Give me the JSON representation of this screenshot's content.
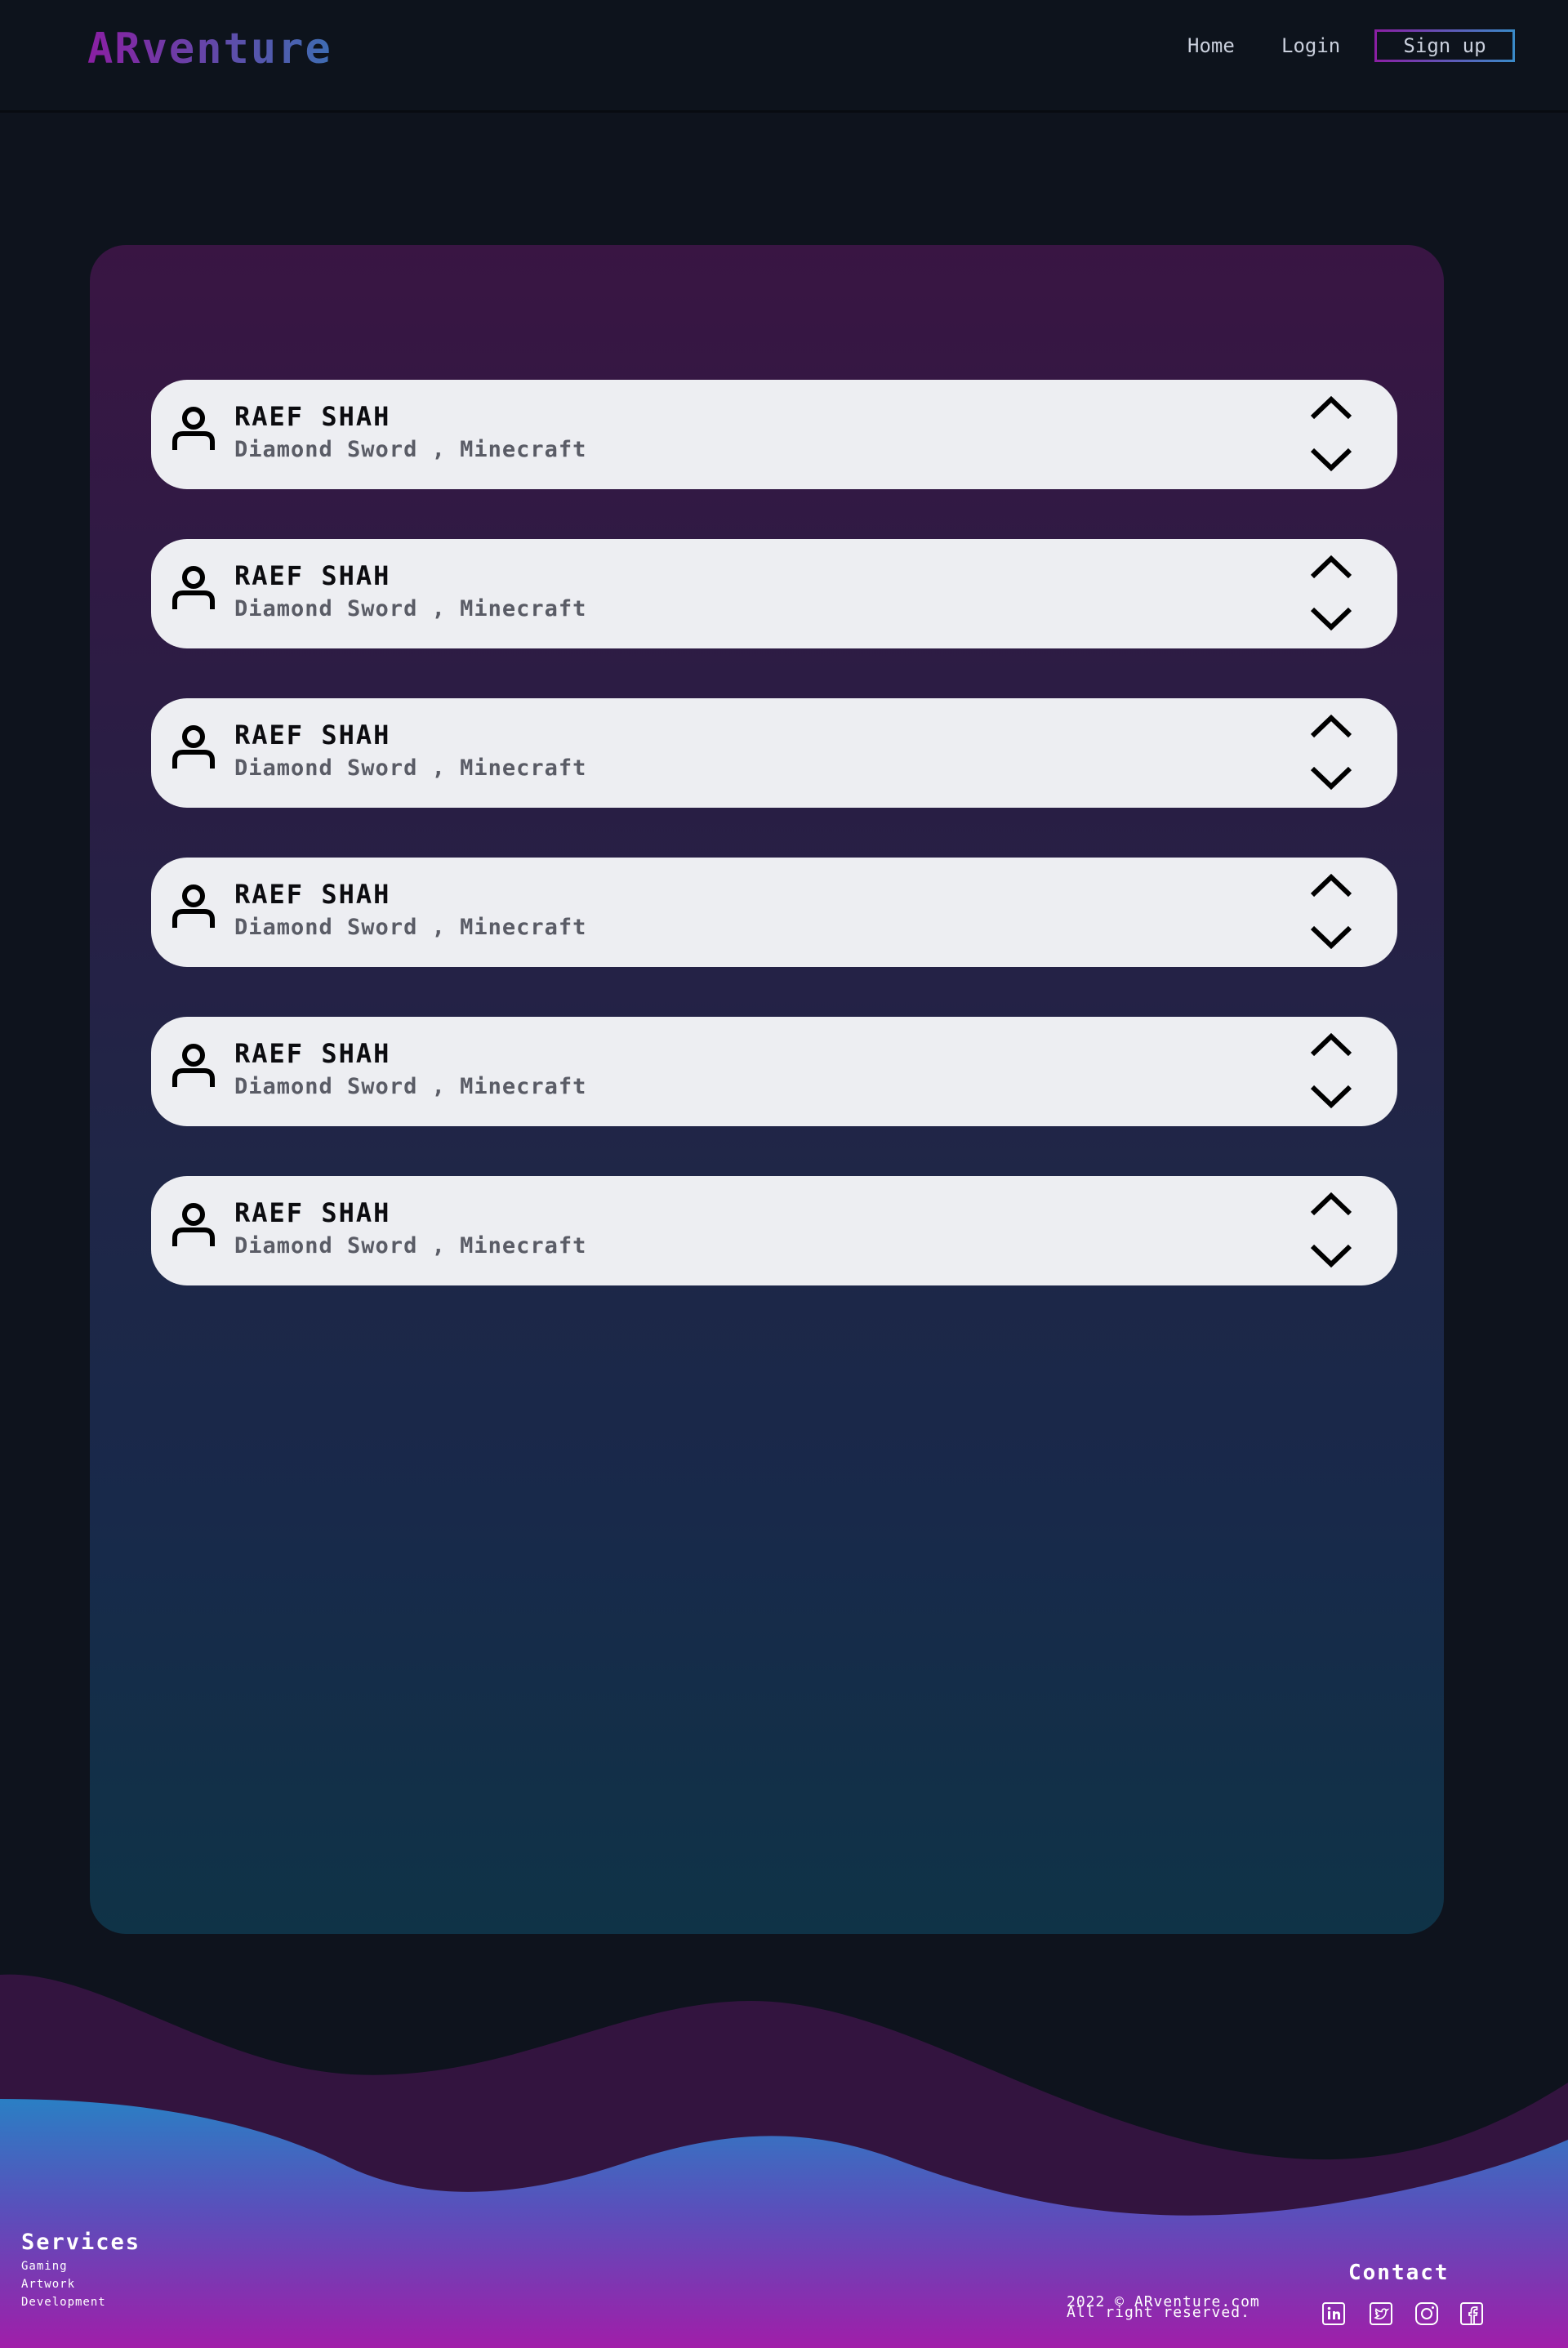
{
  "nav": {
    "logo": "ARventure",
    "links": [
      {
        "label": "Home"
      },
      {
        "label": "Login"
      }
    ],
    "signup_label": "Sign up"
  },
  "list": {
    "items": [
      {
        "name": "RAEF SHAH",
        "item": "Diamond Sword , Minecraft"
      },
      {
        "name": "RAEF SHAH",
        "item": "Diamond Sword , Minecraft"
      },
      {
        "name": "RAEF SHAH",
        "item": "Diamond Sword , Minecraft"
      },
      {
        "name": "RAEF SHAH",
        "item": "Diamond Sword , Minecraft"
      },
      {
        "name": "RAEF SHAH",
        "item": "Diamond Sword , Minecraft"
      },
      {
        "name": "RAEF SHAH",
        "item": "Diamond Sword , Minecraft"
      }
    ]
  },
  "footer": {
    "services_title": "Services",
    "services": [
      "Gaming",
      "Artwork",
      "Development"
    ],
    "contact_title": "Contact",
    "copyright_line1": "2022 © ARventure.com",
    "copyright_line2": "All right reserved.",
    "socials": [
      "linkedin-icon",
      "twitter-icon",
      "instagram-icon",
      "facebook-icon"
    ]
  },
  "colors": {
    "background": "#0e131d",
    "card": "#edeef2",
    "accent_purple": "#8a1fa3",
    "accent_blue": "#3a8ac8"
  }
}
